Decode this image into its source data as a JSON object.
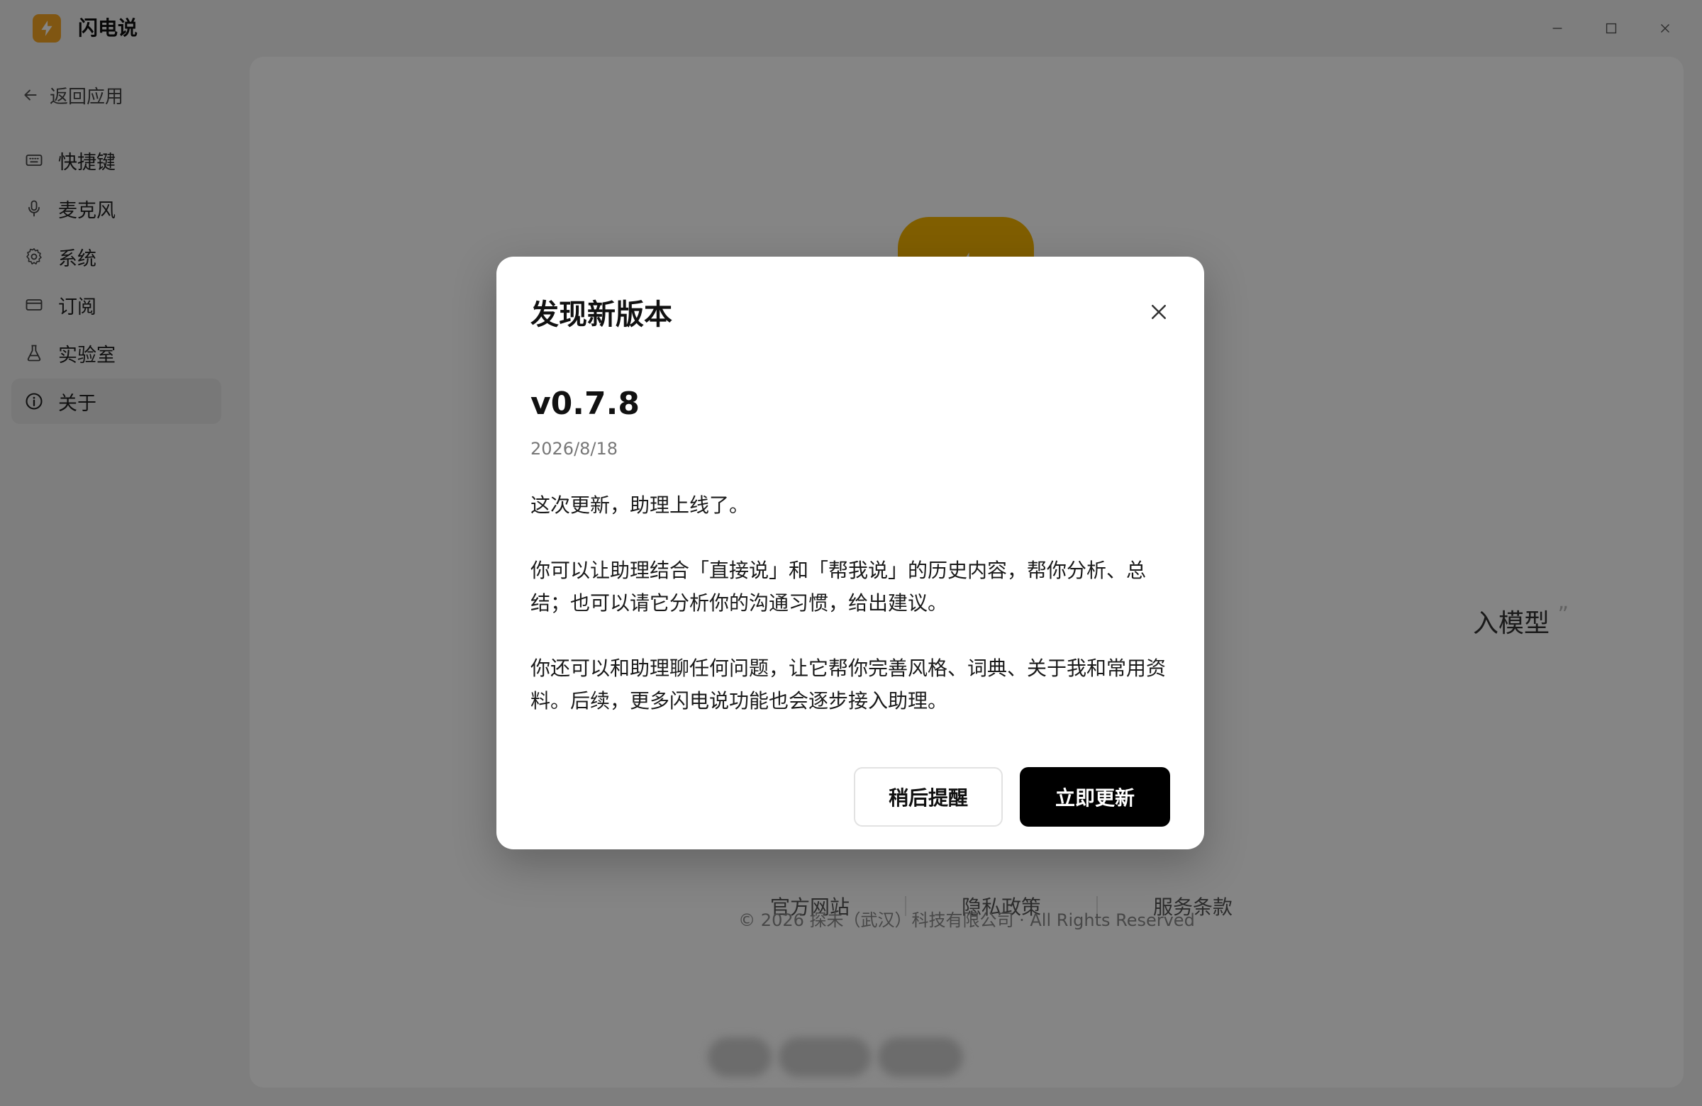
{
  "app": {
    "title": "闪电说",
    "logo_icon": "lightning-bolt-icon",
    "accent_color": "#f5a623"
  },
  "window_controls": [
    "minimize-icon",
    "maximize-icon",
    "close-icon"
  ],
  "sidebar": {
    "back_label": "返回应用",
    "items": [
      {
        "label": "快捷键",
        "icon": "keyboard-icon"
      },
      {
        "label": "麦克风",
        "icon": "microphone-icon"
      },
      {
        "label": "系统",
        "icon": "gear-icon"
      },
      {
        "label": "订阅",
        "icon": "credit-card-icon"
      },
      {
        "label": "实验室",
        "icon": "flask-icon"
      },
      {
        "label": "关于",
        "icon": "info-icon",
        "active": true
      }
    ]
  },
  "about": {
    "slogan_fragment": "入模型",
    "slogan_close_quote": "”",
    "links": [
      "官方网站",
      "隐私政策",
      "服务条款"
    ],
    "copyright": "© 2026 探未（武汉）科技有限公司 · All Rights Reserved"
  },
  "dialog": {
    "title": "发现新版本",
    "version": "v0.7.8",
    "date": "2026/8/18",
    "notes": [
      "这次更新，助理上线了。",
      "你可以让助理结合「直接说」和「帮我说」的历史内容，帮你分析、总结；也可以请它分析你的沟通习惯，给出建议。",
      "你还可以和助理聊任何问题，让它帮你完善风格、词典、关于我和常用资料。后续，更多闪电说功能也会逐步接入助理。"
    ],
    "later_label": "稍后提醒",
    "update_label": "立即更新",
    "update_button_color": "#000000"
  }
}
